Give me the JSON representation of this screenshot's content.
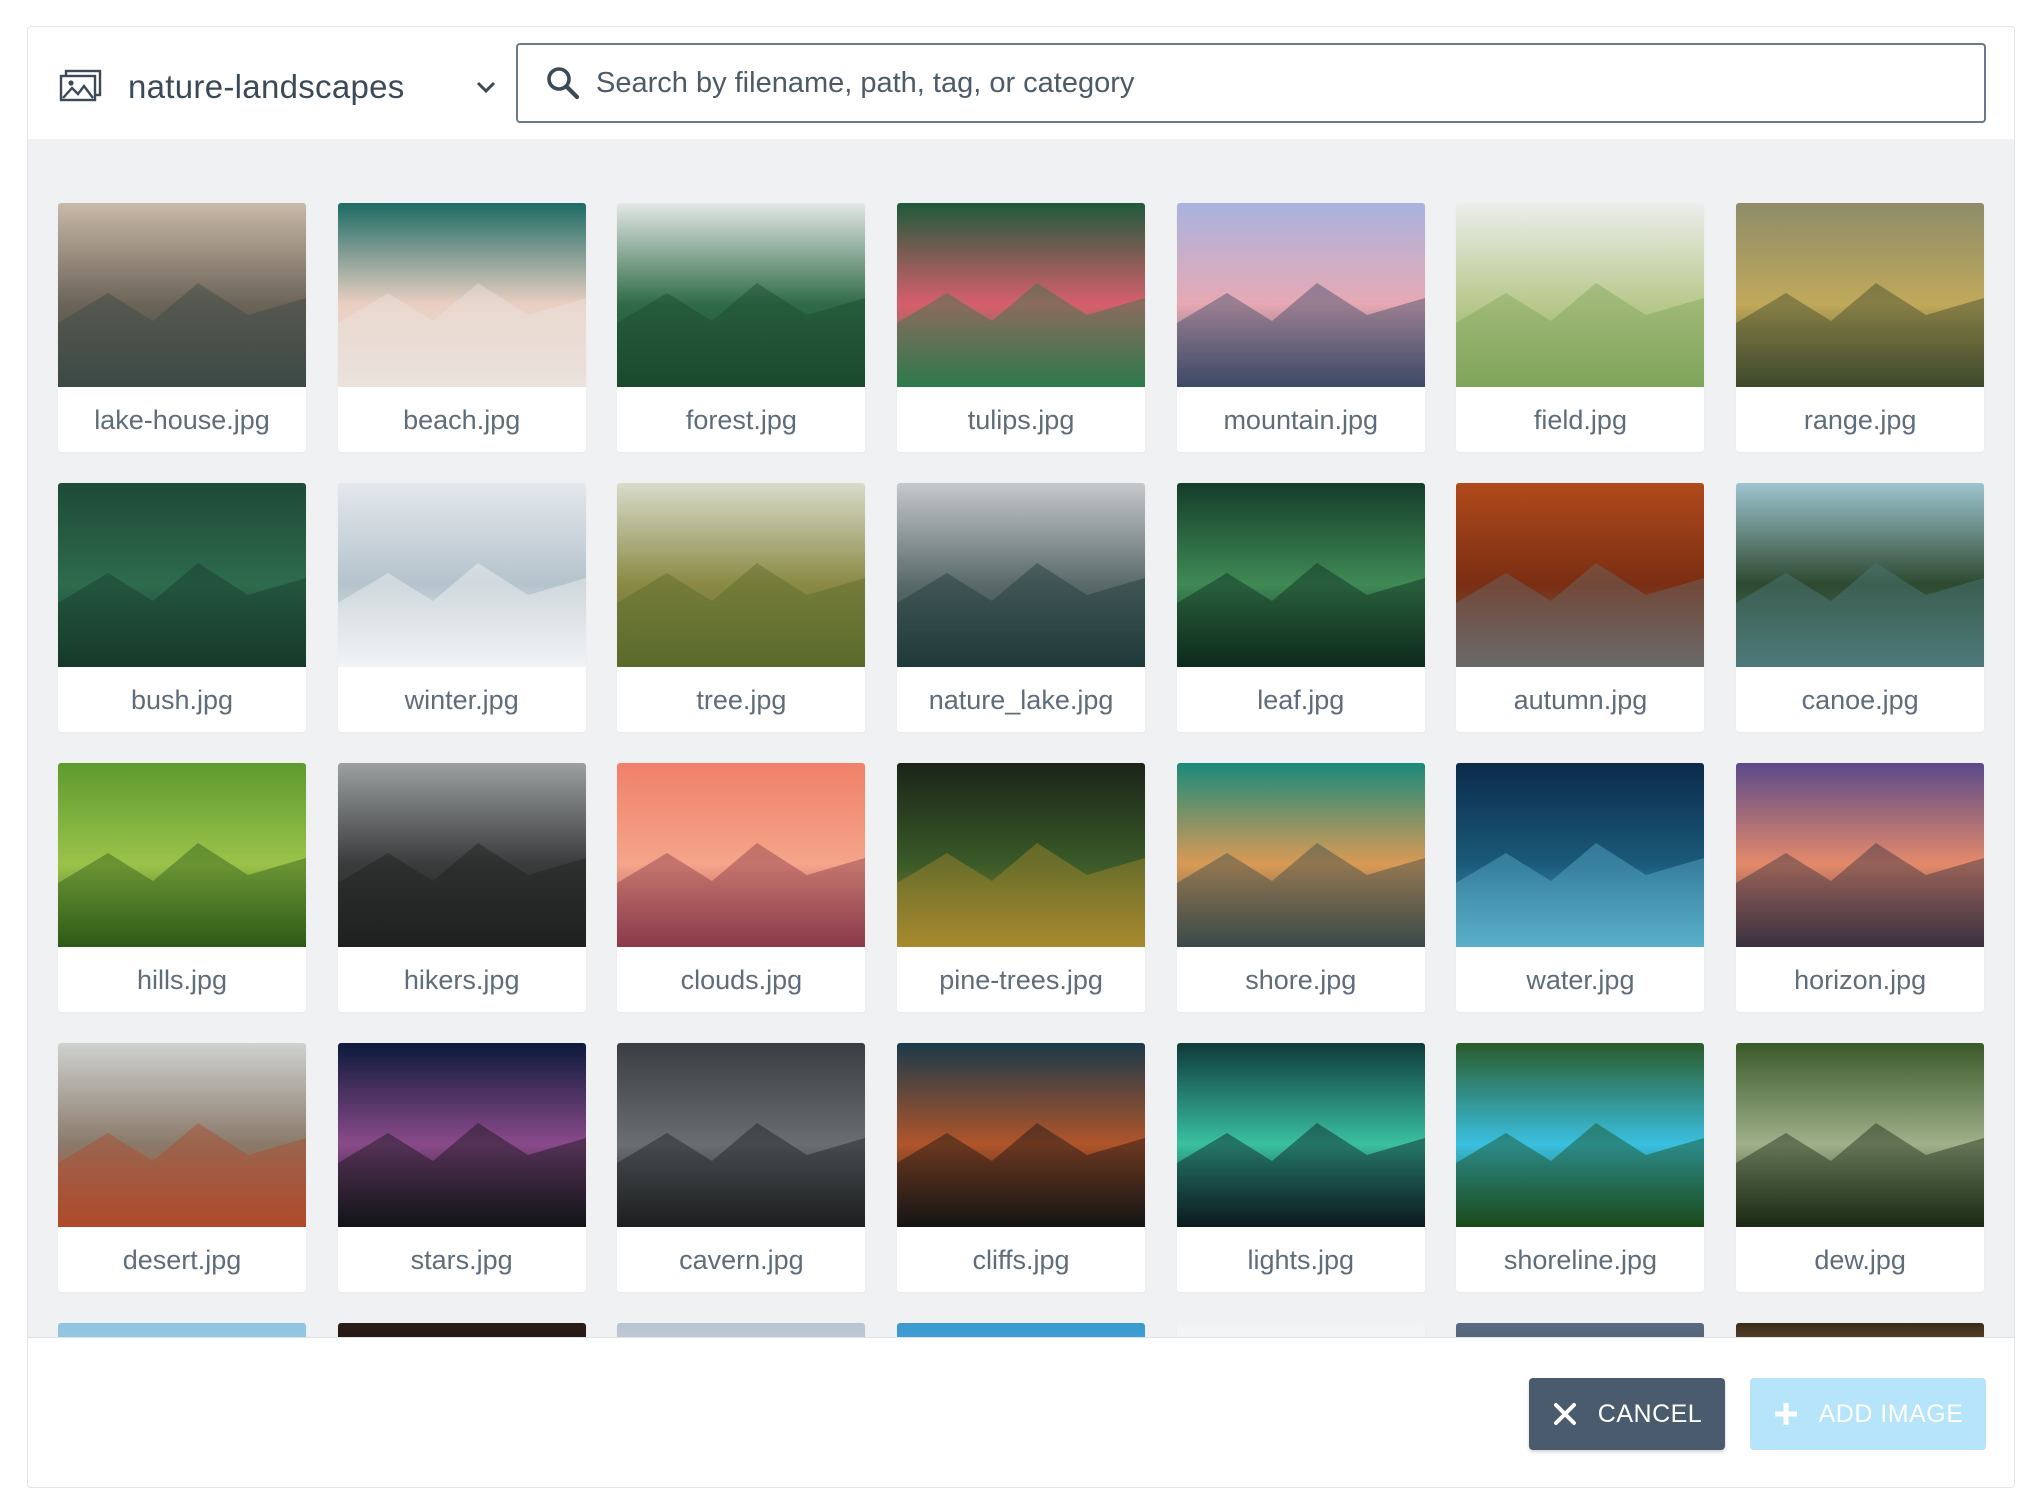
{
  "header": {
    "collection_name": "nature-landscapes",
    "collection_icon": "image-library-icon",
    "dropdown_icon": "chevron-down-icon",
    "search_placeholder": "Search by filename, path, tag, or category",
    "search_value": ""
  },
  "images": [
    {
      "filename": "lake-house.jpg",
      "colors": [
        "#c9b9a8",
        "#6b6458",
        "#3b4a44"
      ]
    },
    {
      "filename": "beach.jpg",
      "colors": [
        "#1d6b64",
        "#e9cfc2",
        "#eae3dd"
      ]
    },
    {
      "filename": "forest.jpg",
      "colors": [
        "#e4e8e6",
        "#2f6b47",
        "#1b4a2e"
      ]
    },
    {
      "filename": "tulips.jpg",
      "colors": [
        "#1f5a3a",
        "#d75f6c",
        "#2c7a4c"
      ]
    },
    {
      "filename": "mountain.jpg",
      "colors": [
        "#a9b3e0",
        "#e7a9b3",
        "#3c4a66"
      ]
    },
    {
      "filename": "field.jpg",
      "colors": [
        "#eceeec",
        "#b9c98d",
        "#7fa55a"
      ]
    },
    {
      "filename": "range.jpg",
      "colors": [
        "#8d8c6a",
        "#c0a95a",
        "#3f4a2c"
      ]
    },
    {
      "filename": "bush.jpg",
      "colors": [
        "#1e4a36",
        "#2e6b4d",
        "#163a2a"
      ]
    },
    {
      "filename": "winter.jpg",
      "colors": [
        "#e3e8ec",
        "#b5c3cc",
        "#f1f3f5"
      ]
    },
    {
      "filename": "tree.jpg",
      "colors": [
        "#d9dccb",
        "#8a8a44",
        "#5a6a2c"
      ]
    },
    {
      "filename": "nature_lake.jpg",
      "colors": [
        "#c6c9cc",
        "#5a6a6a",
        "#1f3a3a"
      ]
    },
    {
      "filename": "leaf.jpg",
      "colors": [
        "#153d2a",
        "#3f8a55",
        "#0e2a1c"
      ]
    },
    {
      "filename": "autumn.jpg",
      "colors": [
        "#b04a1c",
        "#7a2e12",
        "#6a6a6a"
      ]
    },
    {
      "filename": "canoe.jpg",
      "colors": [
        "#9dc4d0",
        "#2e4a30",
        "#4d7a7a"
      ]
    },
    {
      "filename": "hills.jpg",
      "colors": [
        "#5d9a2e",
        "#9bc34a",
        "#2e5a18"
      ]
    },
    {
      "filename": "hikers.jpg",
      "colors": [
        "#9da0a1",
        "#3a3c3c",
        "#1e2020"
      ]
    },
    {
      "filename": "clouds.jpg",
      "colors": [
        "#f0806a",
        "#f5a58a",
        "#8a3a4a"
      ]
    },
    {
      "filename": "pine-trees.jpg",
      "colors": [
        "#1a2418",
        "#3a5a28",
        "#a88a2e"
      ]
    },
    {
      "filename": "shore.jpg",
      "colors": [
        "#1a8a7a",
        "#d99a55",
        "#3a4a4a"
      ]
    },
    {
      "filename": "water.jpg",
      "colors": [
        "#0c2a4a",
        "#1a5a7a",
        "#5ab0c9"
      ]
    },
    {
      "filename": "horizon.jpg",
      "colors": [
        "#5a4a8a",
        "#e48a6a",
        "#3a3040"
      ]
    },
    {
      "filename": "desert.jpg",
      "colors": [
        "#cfd2d0",
        "#8a7a6a",
        "#b04a2a"
      ]
    },
    {
      "filename": "stars.jpg",
      "colors": [
        "#0c1a3a",
        "#8a4a8a",
        "#121416"
      ]
    },
    {
      "filename": "cavern.jpg",
      "colors": [
        "#3a3e42",
        "#6a6e72",
        "#1c1e20"
      ]
    },
    {
      "filename": "cliffs.jpg",
      "colors": [
        "#1a3a4a",
        "#b0552a",
        "#151515"
      ]
    },
    {
      "filename": "lights.jpg",
      "colors": [
        "#0e3a3a",
        "#3ac0a0",
        "#0a1a20"
      ]
    },
    {
      "filename": "shoreline.jpg",
      "colors": [
        "#2a5a2a",
        "#3ac0e0",
        "#1a4a1a"
      ]
    },
    {
      "filename": "dew.jpg",
      "colors": [
        "#3a5a2a",
        "#a0b08a",
        "#1a2a14"
      ]
    },
    {
      "filename": "",
      "colors": [
        "#8fc4e0",
        "#b0d4e8",
        "#ffffff"
      ]
    },
    {
      "filename": "",
      "colors": [
        "#2a1c18",
        "#1a1210",
        "#3a2a20"
      ]
    },
    {
      "filename": "",
      "colors": [
        "#b8c4d0",
        "#dfe4ea",
        "#ffffff"
      ]
    },
    {
      "filename": "",
      "colors": [
        "#3a9ad0",
        "#5ab0e0",
        "#ffffff"
      ]
    },
    {
      "filename": "",
      "colors": [
        "#f2f3f4",
        "#ffffff",
        "#ffffff"
      ]
    },
    {
      "filename": "",
      "colors": [
        "#5a6a80",
        "#3a4a5a",
        "#ffffff"
      ]
    },
    {
      "filename": "",
      "colors": [
        "#3a2a1a",
        "#e8b070",
        "#ffffff"
      ]
    }
  ],
  "footer": {
    "cancel_label": "CANCEL",
    "cancel_icon": "close-icon",
    "add_label": "ADD IMAGE",
    "add_icon": "plus-icon",
    "add_disabled": true
  },
  "colors": {
    "cancel_bg": "#4a5b6d",
    "add_disabled_bg": "#b5e4fb",
    "grid_bg": "#f0f1f3",
    "text_dark": "#3c4a57",
    "text_muted": "#5f6d7a"
  }
}
